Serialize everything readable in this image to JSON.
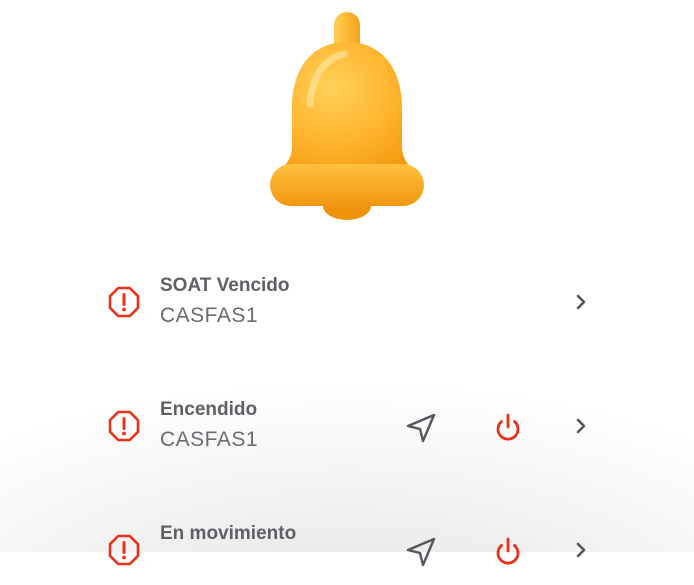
{
  "header": {
    "icon": "bell-icon"
  },
  "alerts": [
    {
      "title": "SOAT Vencido",
      "subtitle": "CASFAS1",
      "has_actions": false
    },
    {
      "title": "Encendido",
      "subtitle": "CASFAS1",
      "has_actions": true
    },
    {
      "title": "En movimiento",
      "subtitle": "",
      "has_actions": true
    }
  ],
  "colors": {
    "warning": "#e8321a",
    "power": "#e8321a",
    "bell": "#ffb02e",
    "title_text": "#5f5f66",
    "subtitle_text": "#6a6a72",
    "icon_gray": "#55555d"
  }
}
